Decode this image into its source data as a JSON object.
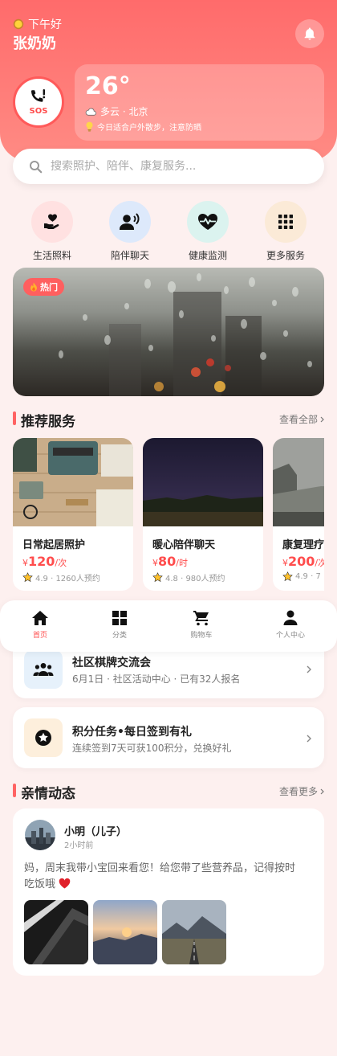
{
  "header": {
    "greeting": "下午好",
    "user_name": "张奶奶",
    "sos_label": "SOS"
  },
  "weather": {
    "temperature": "26°",
    "condition": "多云 · 北京",
    "tip": "今日适合户外散步，注意防晒"
  },
  "search": {
    "placeholder": "搜索照护、陪伴、康复服务..."
  },
  "quick_actions": [
    {
      "label": "生活照料",
      "icon": "hand-heart-icon",
      "bg": "#ffe1e1",
      "color": "#e0555a"
    },
    {
      "label": "陪伴聊天",
      "icon": "person-speaking-icon",
      "bg": "#dde9fb",
      "color": "#2a2a3a"
    },
    {
      "label": "健康监测",
      "icon": "heartbeat-icon",
      "bg": "#dbf3ef",
      "color": "#2a2a3a"
    },
    {
      "label": "更多服务",
      "icon": "grid-icon",
      "bg": "#fbead7",
      "color": "#2a2a3a"
    }
  ],
  "banner": {
    "badge": "热门"
  },
  "recommended": {
    "title": "推荐服务",
    "link": "查看全部",
    "items": [
      {
        "name": "日常起居照护",
        "currency": "¥",
        "price": "120",
        "unit": "/次",
        "rating": "4.9 · 1260人预约",
        "image": "typewriter-desk"
      },
      {
        "name": "暖心陪伴聊天",
        "currency": "¥",
        "price": "80",
        "unit": "/时",
        "rating": "4.8 · 980人预约",
        "image": "night-sky"
      },
      {
        "name": "康复理疗",
        "currency": "¥",
        "price": "200",
        "unit": "/次",
        "rating": "4.9 · 7",
        "image": "misty-coast"
      }
    ]
  },
  "bottom_nav": {
    "items": [
      {
        "label": "首页",
        "icon": "home-icon"
      },
      {
        "label": "分类",
        "icon": "category-grid-icon"
      },
      {
        "label": "购物车",
        "icon": "cart-icon"
      },
      {
        "label": "个人中心",
        "icon": "person-icon"
      }
    ]
  },
  "activities": [
    {
      "title": "社区棋牌交流会",
      "subtitle": "6月1日 · 社区活动中心 · 已有32人报名",
      "icon": "group-icon",
      "bg": "#e6f1fb"
    },
    {
      "title": "积分任务•每日签到有礼",
      "subtitle": "连续签到7天可获100积分，兑换好礼",
      "icon": "star-badge-icon",
      "bg": "#fdefdc"
    }
  ],
  "family": {
    "title": "亲情动态",
    "link": "查看更多",
    "post": {
      "author": "小明（儿子）",
      "time": "2小时前",
      "text": "妈，周末我带小宝回来看您！给您带了些营养品，记得按时吃饭哦"
    }
  },
  "colors": {
    "primary": "#ff6b6b",
    "price": "#ff4d4d",
    "background": "#fdf0ef"
  }
}
